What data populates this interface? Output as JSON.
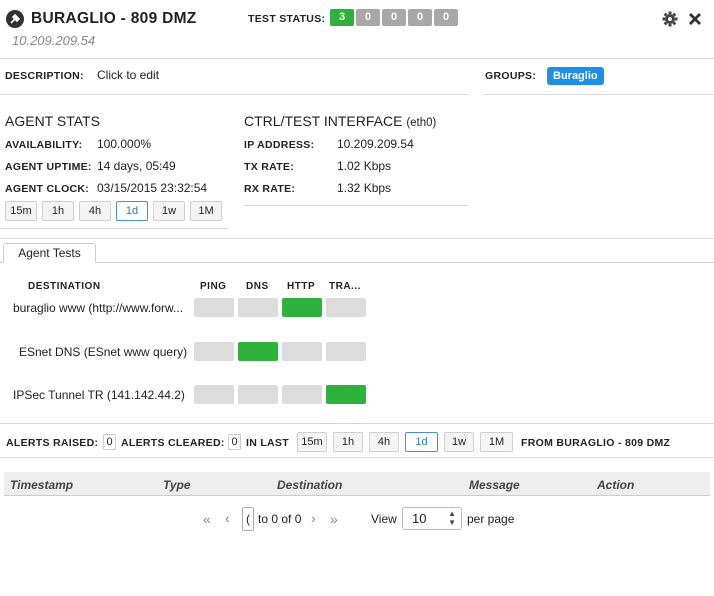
{
  "header": {
    "title": "BURAGLIO - 809 DMZ",
    "ip": "10.209.209.54",
    "test_status_label": "TEST STATUS:",
    "status_counts": [
      {
        "value": "3",
        "color": "#2fb23b"
      },
      {
        "value": "0",
        "color": "#a8a8a8"
      },
      {
        "value": "0",
        "color": "#a8a8a8"
      },
      {
        "value": "0",
        "color": "#a8a8a8"
      },
      {
        "value": "0",
        "color": "#a8a8a8"
      }
    ]
  },
  "description": {
    "label": "DESCRIPTION:",
    "value": "Click to edit"
  },
  "groups": {
    "label": "GROUPS:",
    "tag": "Buraglio"
  },
  "agent_stats": {
    "title": "AGENT STATS",
    "availability_label": "AVAILABILITY:",
    "availability": "100.000%",
    "uptime_label": "AGENT UPTIME:",
    "uptime": "14 days, 05:49",
    "clock_label": "AGENT CLOCK:",
    "clock": "03/15/2015 23:32:54",
    "ranges": [
      "15m",
      "1h",
      "4h",
      "1d",
      "1w",
      "1M"
    ],
    "active_range": "1d"
  },
  "ctrl": {
    "title": "CTRL/TEST INTERFACE",
    "iface": "(eth0)",
    "ip_label": "IP ADDRESS:",
    "ip": "10.209.209.54",
    "tx_label": "TX RATE:",
    "tx": "1.02 Kbps",
    "rx_label": "RX RATE:",
    "rx": "1.32 Kbps"
  },
  "tests": {
    "tab": "Agent Tests",
    "columns": [
      "DESTINATION",
      "PING",
      "DNS",
      "HTTP",
      "TRA..."
    ],
    "rows": [
      {
        "dest": "buraglio www (http://www.forw...",
        "status": [
          "gray",
          "gray",
          "green",
          "gray"
        ]
      },
      {
        "dest": "ESnet DNS (ESnet www query)",
        "status": [
          "gray",
          "green",
          "gray",
          "gray"
        ]
      },
      {
        "dest": "IPSec Tunnel TR (141.142.44.2)",
        "status": [
          "gray",
          "gray",
          "gray",
          "green"
        ]
      }
    ]
  },
  "alerts": {
    "raised_label": "ALERTS RAISED:",
    "raised": "0",
    "cleared_label": "ALERTS CLEARED:",
    "cleared": "0",
    "in_last_label": "IN LAST",
    "ranges": [
      "15m",
      "1h",
      "4h",
      "1d",
      "1w",
      "1M"
    ],
    "active_range": "1d",
    "from_label": "FROM BURAGLIO - 809 DMZ",
    "table_headers": [
      "Timestamp",
      "Type",
      "Destination",
      "Message",
      "Action"
    ],
    "pager": {
      "page": "(",
      "of_text": "to 0 of 0",
      "view_label": "View",
      "per_page": "10",
      "per_page_label": "per page"
    }
  }
}
